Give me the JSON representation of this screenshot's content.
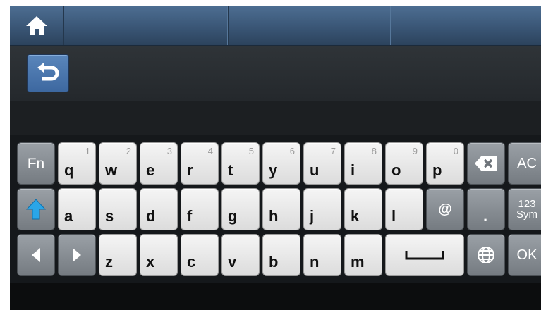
{
  "top_bar": {
    "home_icon": "home-icon"
  },
  "nav": {
    "back_icon": "back-arrow-icon"
  },
  "keyboard": {
    "row1": [
      {
        "label": "q",
        "num": "1"
      },
      {
        "label": "w",
        "num": "2"
      },
      {
        "label": "e",
        "num": "3"
      },
      {
        "label": "r",
        "num": "4"
      },
      {
        "label": "t",
        "num": "5"
      },
      {
        "label": "y",
        "num": "6"
      },
      {
        "label": "u",
        "num": "7"
      },
      {
        "label": "i",
        "num": "8"
      },
      {
        "label": "o",
        "num": "9"
      },
      {
        "label": "p",
        "num": "0"
      }
    ],
    "row2": [
      "a",
      "s",
      "d",
      "f",
      "g",
      "h",
      "j",
      "k",
      "l",
      "@",
      "."
    ],
    "row3": [
      "z",
      "x",
      "c",
      "v",
      "b",
      "n",
      "m"
    ],
    "fn_label": "Fn",
    "ac_label": "AC",
    "sym_label_line1": "123",
    "sym_label_line2": "Sym",
    "ok_label": "OK",
    "icons": {
      "shift": "shift-up-arrow-icon",
      "backspace": "backspace-icon",
      "left": "left-arrow-icon",
      "right": "right-arrow-icon",
      "space": "space-bar-icon",
      "language": "globe-icon"
    },
    "accent_color": "#2aa6e8"
  }
}
